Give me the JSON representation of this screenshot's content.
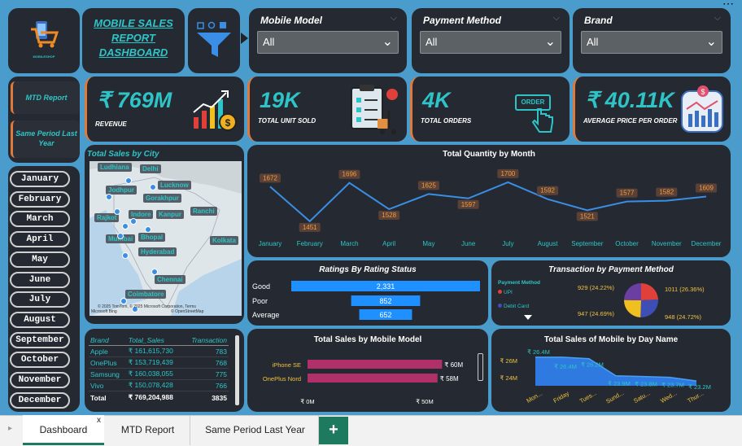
{
  "header": {
    "title_line1": "MOBILE SALES",
    "title_line2": "REPORT",
    "title_line3": "DASHBOARD",
    "logo_text": "MOBILESHOP"
  },
  "filters": {
    "mobile_model": {
      "label": "Mobile Model",
      "value": "All"
    },
    "payment_method": {
      "label": "Payment Method",
      "value": "All"
    },
    "brand": {
      "label": "Brand",
      "value": "All"
    }
  },
  "nav": {
    "mtd_report": "MTD Report",
    "same_period": "Same Period Last Year"
  },
  "kpis": {
    "revenue": {
      "value": "₹ 769M",
      "label": "REVENUE"
    },
    "units": {
      "value": "19K",
      "label": "TOTAL UNIT SOLD"
    },
    "orders": {
      "value": "4K",
      "label": "TOTAL ORDERS",
      "icon_text": "ORDER"
    },
    "avg_price": {
      "value": "₹ 40.11K",
      "label": "AVERAGE PRICE PER ORDER"
    }
  },
  "months": [
    "January",
    "February",
    "March",
    "April",
    "May",
    "June",
    "July",
    "August",
    "September",
    "October",
    "November",
    "December"
  ],
  "map": {
    "title": "Total Sales by City",
    "cities": [
      "Ludhiana",
      "Delhi",
      "Jodhpur",
      "Lucknow",
      "Gorakhpur",
      "Ranchi",
      "Rajkot",
      "Indore",
      "Kanpur",
      "Mumbai",
      "Bhopal",
      "Kolkata",
      "Hyderabad",
      "Chennai",
      "Coimbatore"
    ],
    "attribution": "© 2025 TomTom, © 2025 Microsoft Corporation, Terms",
    "attribution2": "Microsoft Bing",
    "attribution3": "© OpenStreetMap"
  },
  "brand_table": {
    "headers": [
      "Brand",
      "Total_Sales",
      "Transaction"
    ],
    "rows": [
      [
        "Apple",
        "₹ 161,615,730",
        "783"
      ],
      [
        "OnePlus",
        "₹ 153,719,439",
        "768"
      ],
      [
        "Samsung",
        "₹ 160,038,055",
        "775"
      ],
      [
        "Vivo",
        "₹ 150,078,428",
        "766"
      ]
    ],
    "total": [
      "Total",
      "₹ 769,204,988",
      "3835"
    ]
  },
  "charts": {
    "quantity_by_month": {
      "title": "Total Quantity by Month"
    },
    "ratings": {
      "title": "Ratings By Rating Status"
    },
    "payment": {
      "title": "Transaction by Payment Method",
      "legend_title": "Payment Method",
      "legend": [
        "UPI",
        "Debit Card"
      ]
    },
    "mobile_model": {
      "title": "Total Sales by Mobile Model"
    },
    "day_name": {
      "title": "Total Sales of Mobile by Day Name"
    }
  },
  "tabs": {
    "dashboard": "Dashboard",
    "mtd": "MTD Report",
    "same_period": "Same Period Last Year",
    "add": "+",
    "close": "x"
  },
  "chart_data": [
    {
      "type": "line",
      "title": "Total Quantity by Month",
      "categories": [
        "January",
        "February",
        "March",
        "April",
        "May",
        "June",
        "July",
        "August",
        "September",
        "October",
        "November",
        "December"
      ],
      "values": [
        1672,
        1451,
        1696,
        1528,
        1625,
        1597,
        1700,
        1592,
        1521,
        1577,
        1582,
        1609
      ],
      "color": "#3a8ee6"
    },
    {
      "type": "bar",
      "title": "Ratings By Rating Status",
      "categories": [
        "Good",
        "Poor",
        "Average"
      ],
      "values": [
        2331,
        852,
        652
      ],
      "labels": [
        "2,331",
        "852",
        "652"
      ],
      "color": "#1e90ff"
    },
    {
      "type": "pie",
      "title": "Transaction by Payment Method",
      "labels": [
        "929 (24.22%)",
        "1011 (26.36%)",
        "948 (24.72%)",
        "947 (24.69%)"
      ],
      "values": [
        929,
        1011,
        948,
        947
      ],
      "colors": [
        "#e0403a",
        "#3d4fb5",
        "#f0c020",
        "#6b3fa0"
      ]
    },
    {
      "type": "bar",
      "title": "Total Sales by Mobile Model",
      "categories": [
        "iPhone SE",
        "OnePlus Nord"
      ],
      "values": [
        60,
        58
      ],
      "labels": [
        "₹ 60M",
        "₹ 58M"
      ],
      "ticks": [
        "₹ 0M",
        "₹ 50M"
      ],
      "color": "#b0306a"
    },
    {
      "type": "area",
      "title": "Total Sales of Mobile by Day Name",
      "categories": [
        "Mon...",
        "Friday",
        "Tues...",
        "Sund...",
        "Satu...",
        "Wed...",
        "Thur..."
      ],
      "values": [
        26.4,
        26.4,
        26.2,
        23.9,
        23.8,
        23.7,
        23.2
      ],
      "labels": [
        "₹ 26.4M",
        "₹ 26.4M",
        "₹ 26.2M",
        "₹ 23.9M",
        "₹ 23.8M",
        "₹ 23.7M",
        "₹ 23.2M"
      ],
      "y_ticks": [
        "₹ 26M",
        "₹ 24M"
      ],
      "color": "#2f7ae0"
    }
  ]
}
